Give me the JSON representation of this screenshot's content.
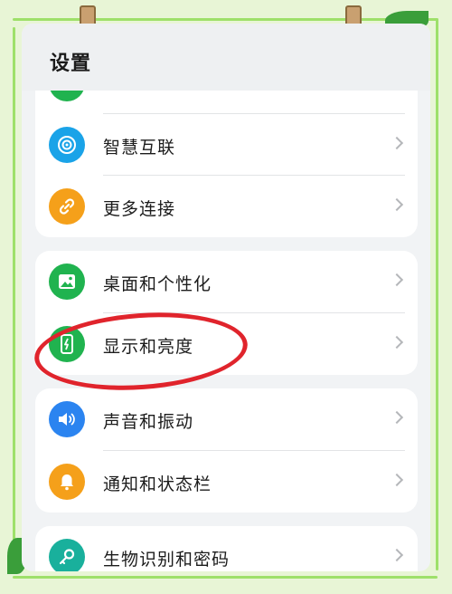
{
  "header": {
    "title": "设置"
  },
  "groups": [
    {
      "items": [
        {
          "label": "智慧互联",
          "icon": "connection-target-icon",
          "color": "#1aa3e8"
        },
        {
          "label": "更多连接",
          "icon": "link-icon",
          "color": "#f5a01a"
        }
      ]
    },
    {
      "items": [
        {
          "label": "桌面和个性化",
          "icon": "image-icon",
          "color": "#20b34f"
        },
        {
          "label": "显示和亮度",
          "icon": "display-brightness-icon",
          "color": "#20b34f"
        }
      ]
    },
    {
      "items": [
        {
          "label": "声音和振动",
          "icon": "speaker-icon",
          "color": "#2b84f0"
        },
        {
          "label": "通知和状态栏",
          "icon": "bell-icon",
          "color": "#f5a01a"
        }
      ]
    },
    {
      "items": [
        {
          "label": "生物识别和密码",
          "icon": "key-icon",
          "color": "#19b09c"
        }
      ]
    }
  ],
  "colors": {
    "background": "#e8f5d6",
    "annotation": "#e0242c"
  }
}
